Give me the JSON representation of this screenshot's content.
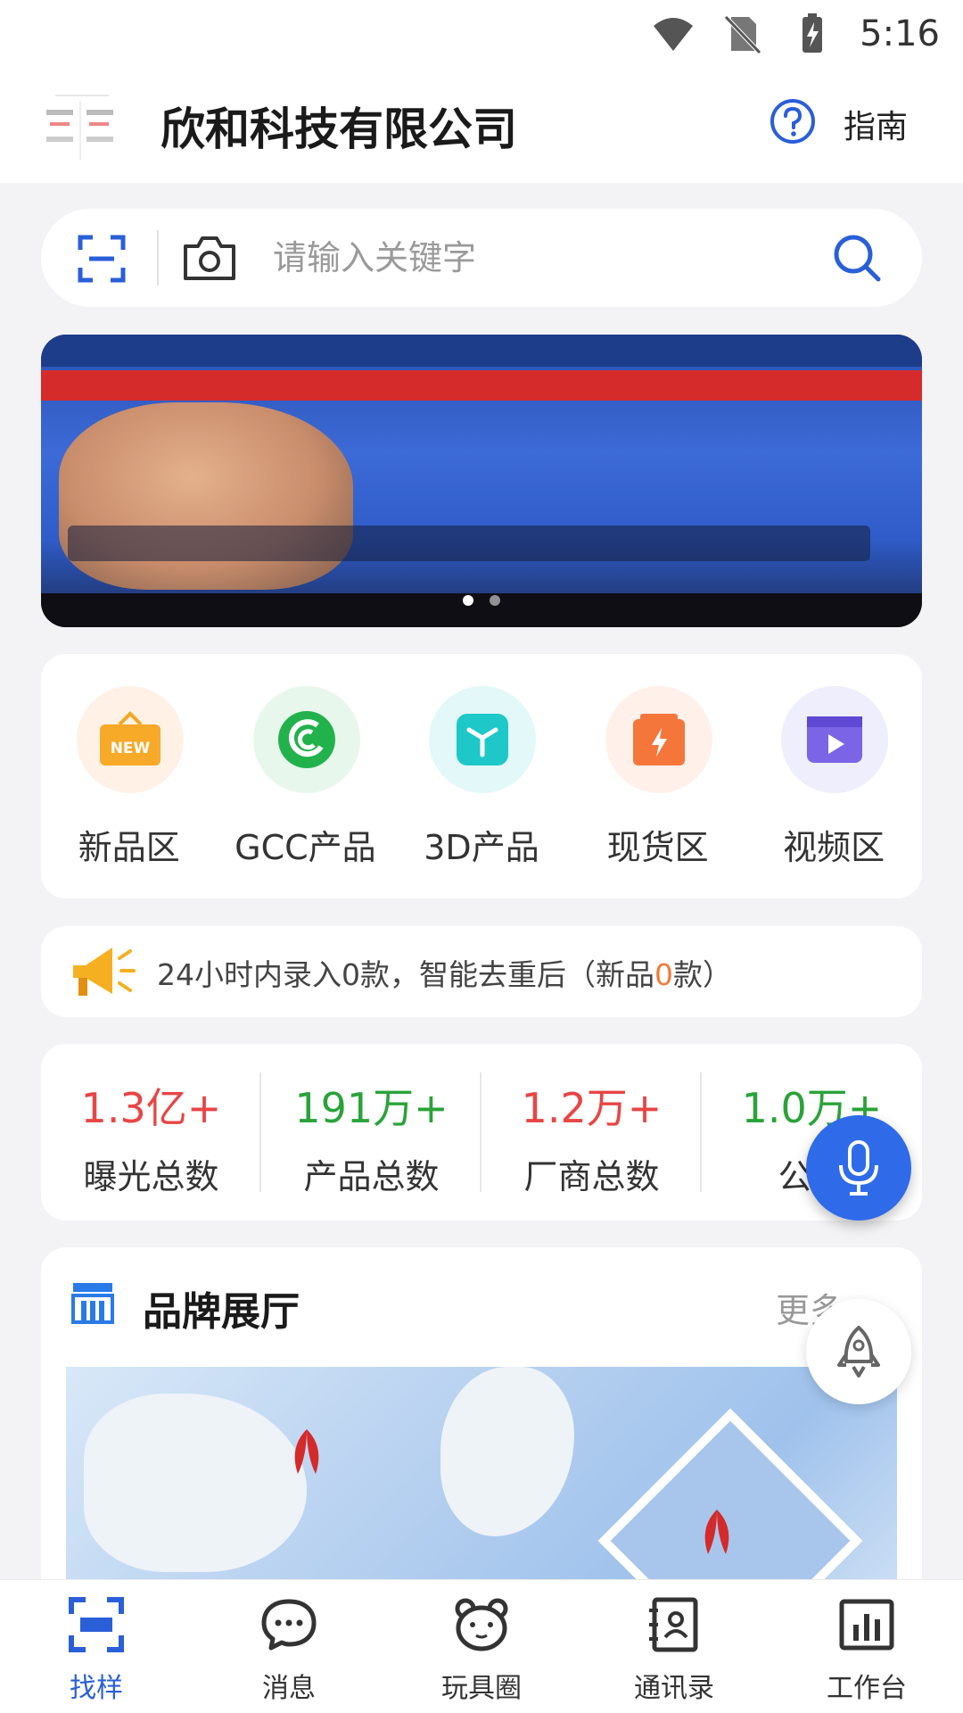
{
  "status": {
    "time": "5:16"
  },
  "header": {
    "company": "欣和科技有限公司",
    "guide": "指南"
  },
  "search": {
    "placeholder": "请输入关键字"
  },
  "categories": [
    {
      "label": "新品区",
      "icon": "new-bag-icon",
      "color": "#fff1e6"
    },
    {
      "label": "GCC产品",
      "icon": "gcc-icon",
      "color": "#e8f7ec"
    },
    {
      "label": "3D产品",
      "icon": "cube-icon",
      "color": "#e3f8f8"
    },
    {
      "label": "现货区",
      "icon": "bolt-box-icon",
      "color": "#fff0ea"
    },
    {
      "label": "视频区",
      "icon": "video-icon",
      "color": "#eeeefc"
    }
  ],
  "notice": {
    "prefix": "24小时内录入0款，智能去重后（新品",
    "count": "0",
    "suffix": "款）"
  },
  "stats": [
    {
      "value": "1.3亿+",
      "label": "曝光总数",
      "color": "#e84545"
    },
    {
      "value": "191万+",
      "label": "产品总数",
      "color": "#2aa33a"
    },
    {
      "value": "1.2万+",
      "label": "厂商总数",
      "color": "#e84545"
    },
    {
      "value": "1.0万+",
      "label": "公司",
      "color": "#2aa33a"
    }
  ],
  "brand": {
    "title": "品牌展厅",
    "more": "更多"
  },
  "tabs": [
    {
      "label": "找样",
      "active": true
    },
    {
      "label": "消息"
    },
    {
      "label": "玩具圈"
    },
    {
      "label": "通讯录"
    },
    {
      "label": "工作台"
    }
  ]
}
